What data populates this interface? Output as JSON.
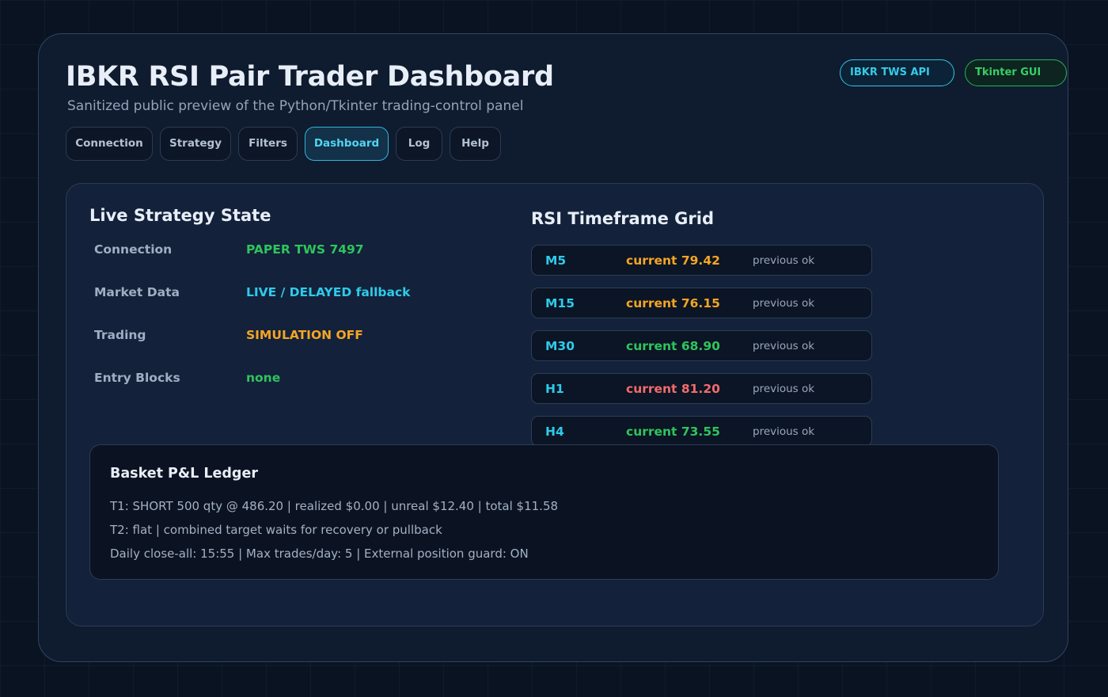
{
  "header": {
    "title": "IBKR RSI Pair Trader Dashboard",
    "subtitle": "Sanitized public preview of the Python/Tkinter trading-control panel",
    "badges": [
      "IBKR TWS API",
      "Tkinter GUI"
    ]
  },
  "tabs": [
    {
      "label": "Connection",
      "active": false
    },
    {
      "label": "Strategy",
      "active": false
    },
    {
      "label": "Filters",
      "active": false
    },
    {
      "label": "Dashboard",
      "active": true
    },
    {
      "label": "Log",
      "active": false
    },
    {
      "label": "Help",
      "active": false
    }
  ],
  "live_state": {
    "title": "Live Strategy State",
    "rows": [
      {
        "label": "Connection",
        "value": "PAPER TWS 7497",
        "color": "#2fc45c"
      },
      {
        "label": "Market Data",
        "value": "LIVE / DELAYED fallback",
        "color": "#2ecbea"
      },
      {
        "label": "Trading",
        "value": "SIMULATION OFF",
        "color": "#f5a524"
      },
      {
        "label": "Entry Blocks",
        "value": "none",
        "color": "#2fc45c"
      }
    ]
  },
  "rsi_grid": {
    "title": "RSI Timeframe Grid",
    "rows": [
      {
        "timeframe": "M5",
        "current": "current 79.42",
        "previous": "previous ok",
        "color": "#f5a524"
      },
      {
        "timeframe": "M15",
        "current": "current 76.15",
        "previous": "previous ok",
        "color": "#f5a524"
      },
      {
        "timeframe": "M30",
        "current": "current 68.90",
        "previous": "previous ok",
        "color": "#2fc45c"
      },
      {
        "timeframe": "H1",
        "current": "current 81.20",
        "previous": "previous ok",
        "color": "#f26b6b"
      },
      {
        "timeframe": "H4",
        "current": "current 73.55",
        "previous": "previous ok",
        "color": "#2fc45c"
      }
    ]
  },
  "ledger": {
    "title": "Basket P&L Ledger",
    "lines": [
      "T1: SHORT 500 qty @ 486.20 | realized $0.00 | unreal $12.40 | total $11.58",
      "T2: flat | combined target waits for recovery or pullback",
      "Daily close-all: 15:55 | Max trades/day: 5 | External position guard: ON"
    ]
  }
}
